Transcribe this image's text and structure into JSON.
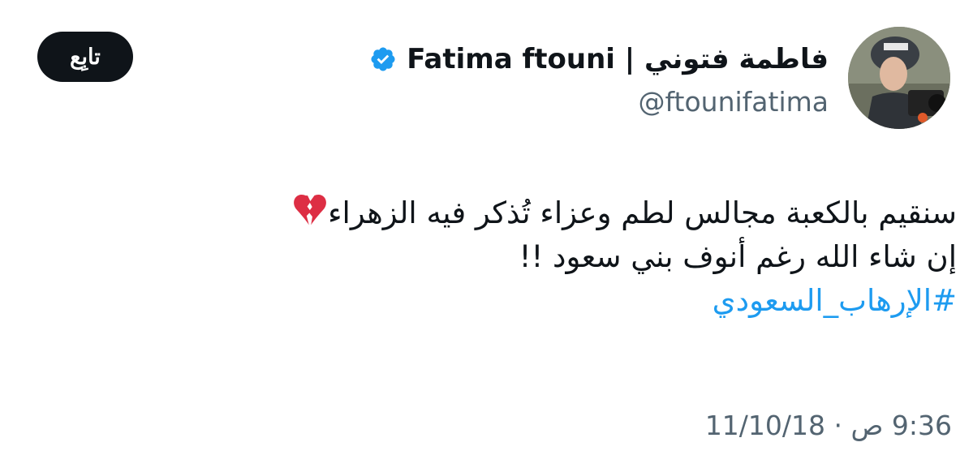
{
  "tweet": {
    "display_name": "فاطمة فتوني | Fatima ftouni",
    "handle": "@ftounifatima",
    "verified": true,
    "follow_label": "تابِع",
    "body_line1": "سنقيم بالكعبة مجالس لطم وعزاء تُذكر فيه الزهراء",
    "body_line2": "إن شاء الله رغم أنوف بني سعود !!",
    "hashtag": "#الإرهاب_السعودي",
    "timestamp": "9:36 ص · 11/10/18",
    "emoji": "broken-heart-icon"
  },
  "colors": {
    "text": "#0f1419",
    "secondary": "#536471",
    "link": "#1d9bf0",
    "button_bg": "#0f1419",
    "verified": "#1d9bf0"
  }
}
